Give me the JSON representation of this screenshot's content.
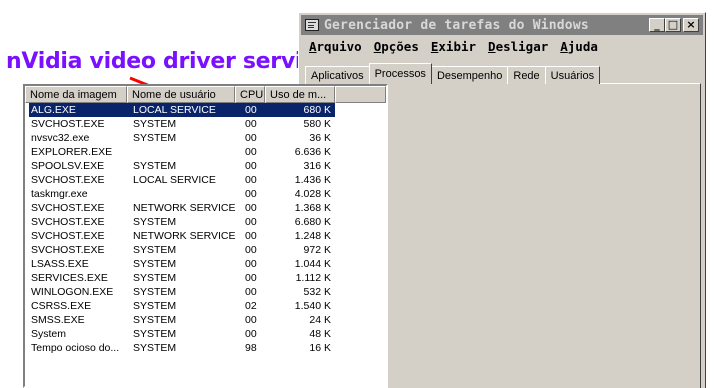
{
  "annotation": {
    "text": "nVidia video driver service",
    "color": "#7a10ff",
    "arrow_color": "#ff0000"
  },
  "window": {
    "title": "Gerenciador de tarefas do Windows",
    "buttons": {
      "minimize": "_",
      "maximize": "□",
      "close": "×"
    }
  },
  "menu": [
    {
      "first": "A",
      "rest": "rquivo"
    },
    {
      "first": "O",
      "rest": "pções"
    },
    {
      "first": "E",
      "rest": "xibir"
    },
    {
      "first": "D",
      "rest": "esligar"
    },
    {
      "first": "A",
      "rest": "juda"
    }
  ],
  "tabs": [
    "Aplicativos",
    "Processos",
    "Desempenho",
    "Rede",
    "Usuários"
  ],
  "active_tab": "Processos",
  "columns": [
    "Nome da imagem",
    "Nome de usuário",
    "CPU",
    "Uso de m..."
  ],
  "processes": [
    {
      "name": "ALG.EXE",
      "user": "LOCAL SERVICE",
      "cpu": "00",
      "mem": "680 K",
      "selected": true
    },
    {
      "name": "SVCHOST.EXE",
      "user": "SYSTEM",
      "cpu": "00",
      "mem": "580 K"
    },
    {
      "name": "nvsvc32.exe",
      "user": "SYSTEM",
      "cpu": "00",
      "mem": "36 K"
    },
    {
      "name": "EXPLORER.EXE",
      "user": "",
      "cpu": "00",
      "mem": "6.636 K"
    },
    {
      "name": "SPOOLSV.EXE",
      "user": "SYSTEM",
      "cpu": "00",
      "mem": "316 K"
    },
    {
      "name": "SVCHOST.EXE",
      "user": "LOCAL SERVICE",
      "cpu": "00",
      "mem": "1.436 K"
    },
    {
      "name": "taskmgr.exe",
      "user": "",
      "cpu": "00",
      "mem": "4.028 K"
    },
    {
      "name": "SVCHOST.EXE",
      "user": "NETWORK SERVICE",
      "cpu": "00",
      "mem": "1.368 K"
    },
    {
      "name": "SVCHOST.EXE",
      "user": "SYSTEM",
      "cpu": "00",
      "mem": "6.680 K"
    },
    {
      "name": "SVCHOST.EXE",
      "user": "NETWORK SERVICE",
      "cpu": "00",
      "mem": "1.248 K"
    },
    {
      "name": "SVCHOST.EXE",
      "user": "SYSTEM",
      "cpu": "00",
      "mem": "972 K"
    },
    {
      "name": "LSASS.EXE",
      "user": "SYSTEM",
      "cpu": "00",
      "mem": "1.044 K"
    },
    {
      "name": "SERVICES.EXE",
      "user": "SYSTEM",
      "cpu": "00",
      "mem": "1.112 K"
    },
    {
      "name": "WINLOGON.EXE",
      "user": "SYSTEM",
      "cpu": "00",
      "mem": "532 K"
    },
    {
      "name": "CSRSS.EXE",
      "user": "SYSTEM",
      "cpu": "02",
      "mem": "1.540 K"
    },
    {
      "name": "SMSS.EXE",
      "user": "SYSTEM",
      "cpu": "00",
      "mem": "24 K"
    },
    {
      "name": "System",
      "user": "SYSTEM",
      "cpu": "00",
      "mem": "48 K"
    },
    {
      "name": "Tempo ocioso do...",
      "user": "SYSTEM",
      "cpu": "98",
      "mem": "16 K"
    }
  ]
}
